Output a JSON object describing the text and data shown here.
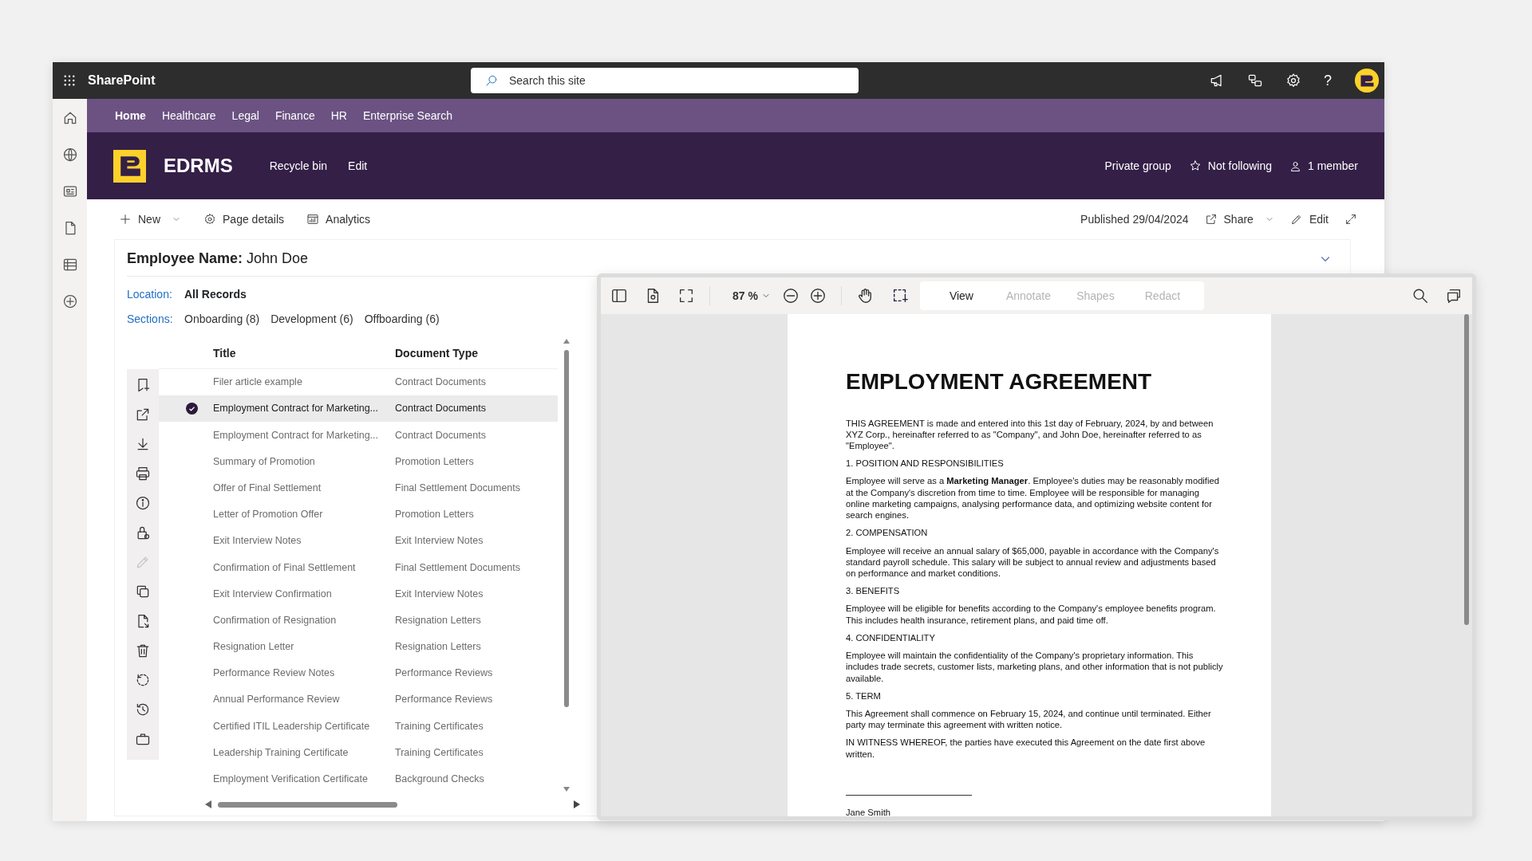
{
  "suite_bar": {
    "app_name": "SharePoint",
    "search": {
      "placeholder": "Search this site"
    },
    "help": "?"
  },
  "hub_nav": [
    {
      "label": "Home",
      "selected": true
    },
    {
      "label": "Healthcare",
      "selected": false
    },
    {
      "label": "Legal",
      "selected": false
    },
    {
      "label": "Finance",
      "selected": false
    },
    {
      "label": "HR",
      "selected": false
    },
    {
      "label": "Enterprise Search",
      "selected": false
    }
  ],
  "site_header": {
    "title": "EDRMS",
    "links": [
      "Recycle bin",
      "Edit"
    ],
    "privacy": "Private group",
    "follow": "Not following",
    "members": "1 member"
  },
  "command_bar": {
    "new": "New",
    "page_details": "Page details",
    "analytics": "Analytics",
    "published": "Published 29/04/2024",
    "share": "Share",
    "edit": "Edit"
  },
  "record": {
    "heading": "**Employee Name:** John Doe",
    "location_label": "Location:",
    "location": "All Records",
    "sections_label": "Sections:",
    "sections": [
      "Onboarding (8)",
      "Development (6)",
      "Offboarding (6)"
    ]
  },
  "action_rail": [
    {
      "kind": "bookmark",
      "disabled": false
    },
    {
      "kind": "share",
      "disabled": false
    },
    {
      "kind": "download",
      "disabled": false
    },
    {
      "kind": "print",
      "disabled": false
    },
    {
      "kind": "info",
      "disabled": false
    },
    {
      "kind": "lock",
      "disabled": false
    },
    {
      "kind": "pencil",
      "disabled": true
    },
    {
      "kind": "copy",
      "disabled": false
    },
    {
      "kind": "file-move",
      "disabled": false
    },
    {
      "kind": "trash",
      "disabled": false
    },
    {
      "kind": "sync",
      "disabled": false
    },
    {
      "kind": "history",
      "disabled": false
    },
    {
      "kind": "briefcase",
      "disabled": false
    }
  ],
  "table": {
    "columns": [
      "Title",
      "Document Type"
    ],
    "rows": [
      {
        "title": "Filer article example",
        "type": "Contract Documents",
        "selected": false
      },
      {
        "title": "Employment Contract for Marketing...",
        "type": "Contract Documents",
        "selected": true
      },
      {
        "title": "Employment Contract for Marketing...",
        "type": "Contract Documents",
        "selected": false
      },
      {
        "title": "Summary of Promotion",
        "type": "Promotion Letters",
        "selected": false
      },
      {
        "title": "Offer of Final Settlement",
        "type": "Final Settlement Documents",
        "selected": false
      },
      {
        "title": "Letter of Promotion Offer",
        "type": "Promotion Letters",
        "selected": false
      },
      {
        "title": "Exit Interview Notes",
        "type": "Exit Interview Notes",
        "selected": false
      },
      {
        "title": "Confirmation of Final Settlement",
        "type": "Final Settlement Documents",
        "selected": false
      },
      {
        "title": "Exit Interview Confirmation",
        "type": "Exit Interview Notes",
        "selected": false
      },
      {
        "title": "Confirmation of Resignation",
        "type": "Resignation Letters",
        "selected": false
      },
      {
        "title": "Resignation Letter",
        "type": "Resignation Letters",
        "selected": false
      },
      {
        "title": "Performance Review Notes",
        "type": "Performance Reviews",
        "selected": false
      },
      {
        "title": "Annual Performance Review",
        "type": "Performance Reviews",
        "selected": false
      },
      {
        "title": "Certified ITIL Leadership Certificate",
        "type": "Training Certificates",
        "selected": false
      },
      {
        "title": "Leadership Training Certificate",
        "type": "Training Certificates",
        "selected": false
      },
      {
        "title": "Employment Verification Certificate",
        "type": "Background Checks",
        "selected": false
      }
    ]
  },
  "viewer": {
    "zoom": "87 %",
    "modes": [
      {
        "label": "View",
        "selected": true
      },
      {
        "label": "Annotate",
        "selected": false
      },
      {
        "label": "Shapes",
        "selected": false
      },
      {
        "label": "Redact",
        "selected": false
      }
    ],
    "document": {
      "title": "EMPLOYMENT AGREEMENT",
      "blocks": [
        {
          "kind": "paragraph",
          "text": "THIS AGREEMENT is made and entered into this 1st day of February, 2024, by and between XYZ Corp., hereinafter referred to as \"Company\", and John Doe, hereinafter referred to as \"Employee\"."
        },
        {
          "kind": "heading",
          "text": "1. POSITION AND RESPONSIBILITIES"
        },
        {
          "kind": "paragraph",
          "text": "Employee will serve as a **Marketing Manager**. Employee's duties may be reasonably modified at the Company's discretion from time to time. Employee will be responsible for managing online marketing campaigns, analysing performance data, and optimizing website content for search engines."
        },
        {
          "kind": "heading",
          "text": "2. COMPENSATION"
        },
        {
          "kind": "paragraph",
          "text": "Employee will receive an annual salary of $65,000, payable in accordance with the Company's standard payroll schedule. This salary will be subject to annual review and adjustments based on performance and market conditions."
        },
        {
          "kind": "heading",
          "text": "3. BENEFITS"
        },
        {
          "kind": "paragraph",
          "text": "Employee will be eligible for benefits according to the Company's employee benefits program. This includes health insurance, retirement plans, and paid time off."
        },
        {
          "kind": "heading",
          "text": "4. CONFIDENTIALITY"
        },
        {
          "kind": "paragraph",
          "text": "Employee will maintain the confidentiality of the Company's proprietary information. This includes trade secrets, customer lists, marketing plans, and other information that is not publicly available."
        },
        {
          "kind": "heading",
          "text": "5. TERM"
        },
        {
          "kind": "paragraph",
          "text": "This Agreement shall commence on February 15, 2024, and continue until terminated. Either party may terminate this agreement with written notice."
        },
        {
          "kind": "paragraph",
          "text": "IN WITNESS WHEREOF, the parties have executed this Agreement on the date first above written."
        },
        {
          "kind": "signature_line"
        },
        {
          "kind": "signatory",
          "text": "Jane Smith"
        }
      ]
    }
  }
}
